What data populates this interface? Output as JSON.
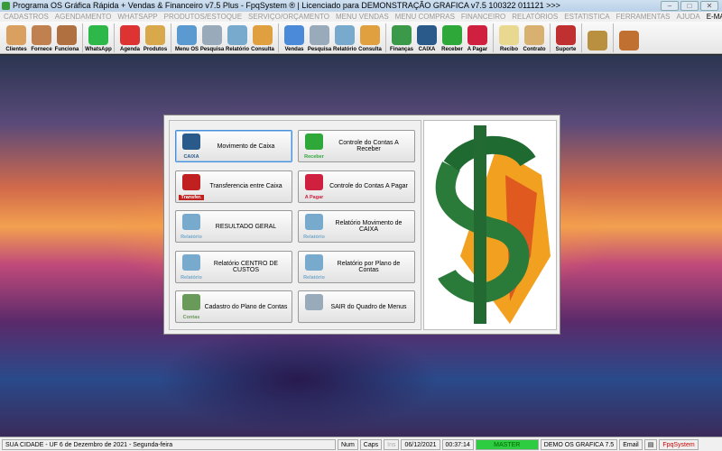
{
  "window": {
    "title": "Programa OS Gráfica Rápida + Vendas & Financeiro v7.5 Plus - FpqSystem ® | Licenciado para  DEMONSTRAÇÃO GRAFICA v7.5 100322 011121 >>>"
  },
  "menu": [
    "CADASTROS",
    "AGENDAMENTO",
    "WHATSAPP",
    "PRODUTOS/ESTOQUE",
    "SERVIÇO/ORÇAMENTO",
    "MENU VENDAS",
    "MENU COMPRAS",
    "FINANCEIRO",
    "RELATÓRIOS",
    "ESTATISTICA",
    "FERRAMENTAS",
    "AJUDA",
    "E-MAIL"
  ],
  "toolbar": [
    {
      "label": "Clientes",
      "color": "#d9a060"
    },
    {
      "label": "Fornece",
      "color": "#c08050"
    },
    {
      "label": "Funciona",
      "color": "#b07040"
    },
    {
      "label": "WhatsApp",
      "color": "#2fb84a"
    },
    {
      "label": "Agenda",
      "color": "#d33"
    },
    {
      "label": "Produtos",
      "color": "#d8a84a"
    },
    {
      "label": "Menu OS",
      "color": "#5a9ad0"
    },
    {
      "label": "Pesquisa",
      "color": "#9ab"
    },
    {
      "label": "Relatório",
      "color": "#7ac"
    },
    {
      "label": "Consulta",
      "color": "#e0a040"
    },
    {
      "label": "Vendas",
      "color": "#4a8ad8"
    },
    {
      "label": "Pesquisa",
      "color": "#9ab"
    },
    {
      "label": "Relatório",
      "color": "#7ac"
    },
    {
      "label": "Consulta",
      "color": "#e0a040"
    },
    {
      "label": "Finanças",
      "color": "#3a9a4a"
    },
    {
      "label": "CAIXA",
      "color": "#2a5a8a"
    },
    {
      "label": "Receber",
      "color": "#2fa83a"
    },
    {
      "label": "A Pagar",
      "color": "#d02040"
    },
    {
      "label": "Recibo",
      "color": "#e8d890"
    },
    {
      "label": "Contrato",
      "color": "#d8b070"
    },
    {
      "label": "Suporte",
      "color": "#c03030"
    },
    {
      "label": "",
      "color": "#b89040"
    },
    {
      "label": "",
      "color": "#c07030"
    }
  ],
  "buttons": [
    {
      "label": "Movimento de Caixa",
      "icon": "CAIXA",
      "color": "#2a5a8a"
    },
    {
      "label": "Controle do Contas A Receber",
      "icon": "Receber",
      "color": "#2fa83a"
    },
    {
      "label": "Transferencia entre Caixa",
      "icon": "Transfer.",
      "color": "#c02020"
    },
    {
      "label": "Controle do Contas A Pagar",
      "icon": "A Pagar",
      "color": "#d02040"
    },
    {
      "label": "RESULTADO GERAL",
      "icon": "Relatório",
      "color": "#7ac"
    },
    {
      "label": "Relatório Movimento de CAIXA",
      "icon": "Relatório",
      "color": "#7ac"
    },
    {
      "label": "Relatório CENTRO DE CUSTOS",
      "icon": "Relatório",
      "color": "#7ac"
    },
    {
      "label": "Relatório por Plano de Contas",
      "icon": "Relatório",
      "color": "#7ac"
    },
    {
      "label": "Cadastro do Plano de Contas",
      "icon": "Contas",
      "color": "#6a9a5a"
    },
    {
      "label": "SAIR do Quadro de Menus",
      "icon": "",
      "color": "#9ab"
    }
  ],
  "status": {
    "city": "SUA CIDADE - UF  6 de Dezembro de 2021 - Segunda-feira",
    "num": "Num",
    "caps": "Caps",
    "ins": "Ins",
    "date": "06/12/2021",
    "time": "00:37:14",
    "user": "MASTER",
    "company": "DEMO OS GRAFICA 7.5",
    "email": "Email",
    "brand": "FpqSystem"
  }
}
